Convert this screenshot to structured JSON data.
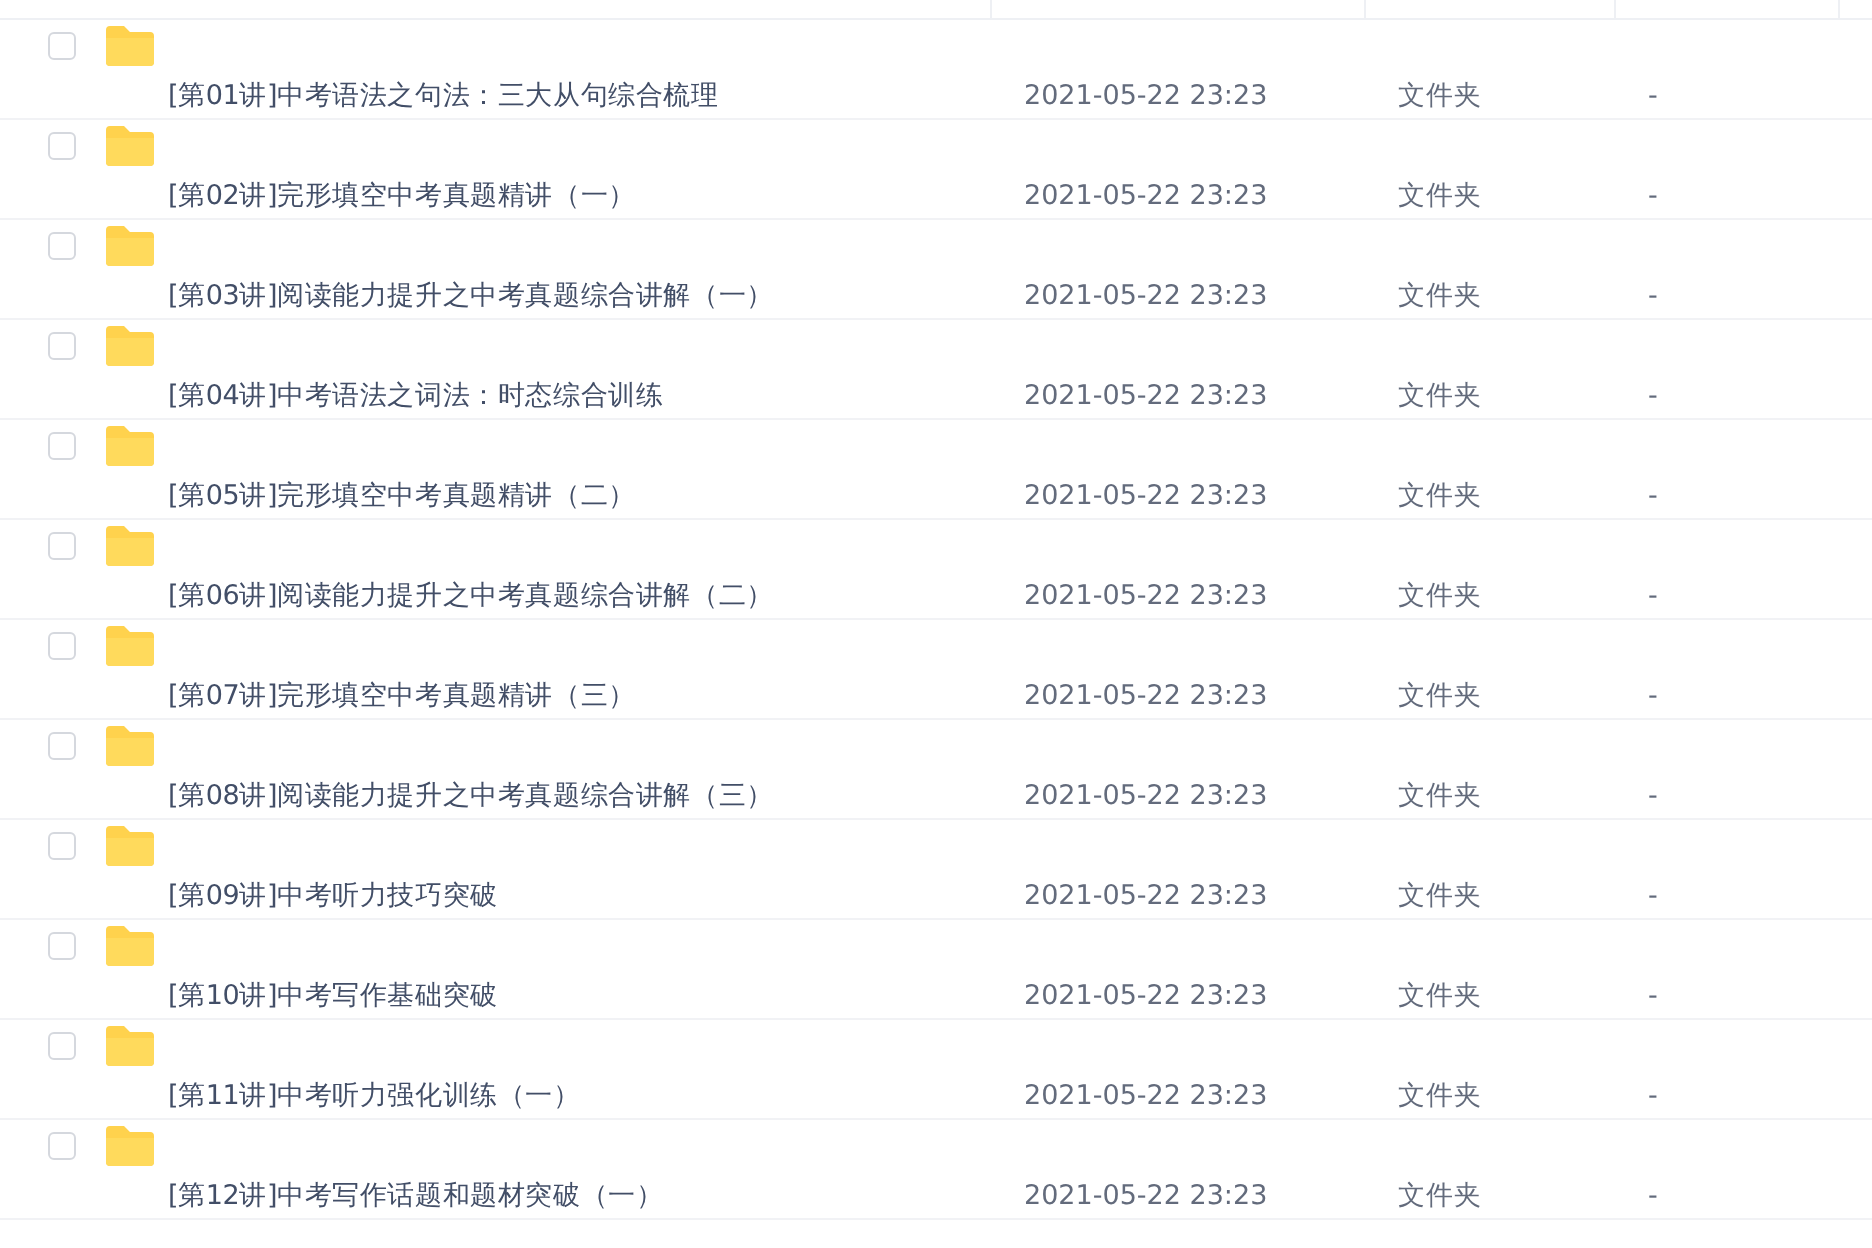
{
  "rows": [
    {
      "name": "[第01讲]中考语法之句法：三大从句综合梳理",
      "modified": "2021-05-22 23:23",
      "type": "文件夹",
      "size": "-",
      "checked": false
    },
    {
      "name": "[第02讲]完形填空中考真题精讲（一）",
      "modified": "2021-05-22 23:23",
      "type": "文件夹",
      "size": "-",
      "checked": false
    },
    {
      "name": "[第03讲]阅读能力提升之中考真题综合讲解（一）",
      "modified": "2021-05-22 23:23",
      "type": "文件夹",
      "size": "-",
      "checked": false
    },
    {
      "name": "[第04讲]中考语法之词法：时态综合训练",
      "modified": "2021-05-22 23:23",
      "type": "文件夹",
      "size": "-",
      "checked": false
    },
    {
      "name": "[第05讲]完形填空中考真题精讲（二）",
      "modified": "2021-05-22 23:23",
      "type": "文件夹",
      "size": "-",
      "checked": false
    },
    {
      "name": "[第06讲]阅读能力提升之中考真题综合讲解（二）",
      "modified": "2021-05-22 23:23",
      "type": "文件夹",
      "size": "-",
      "checked": false
    },
    {
      "name": "[第07讲]完形填空中考真题精讲（三）",
      "modified": "2021-05-22 23:23",
      "type": "文件夹",
      "size": "-",
      "checked": false
    },
    {
      "name": "[第08讲]阅读能力提升之中考真题综合讲解（三）",
      "modified": "2021-05-22 23:23",
      "type": "文件夹",
      "size": "-",
      "checked": false
    },
    {
      "name": "[第09讲]中考听力技巧突破",
      "modified": "2021-05-22 23:23",
      "type": "文件夹",
      "size": "-",
      "checked": false
    },
    {
      "name": "[第10讲]中考写作基础突破",
      "modified": "2021-05-22 23:23",
      "type": "文件夹",
      "size": "-",
      "checked": false
    },
    {
      "name": "[第11讲]中考听力强化训练（一）",
      "modified": "2021-05-22 23:23",
      "type": "文件夹",
      "size": "-",
      "checked": false
    },
    {
      "name": "[第12讲]中考写作话题和题材突破（一）",
      "modified": "2021-05-22 23:23",
      "type": "文件夹",
      "size": "-",
      "checked": false
    }
  ]
}
